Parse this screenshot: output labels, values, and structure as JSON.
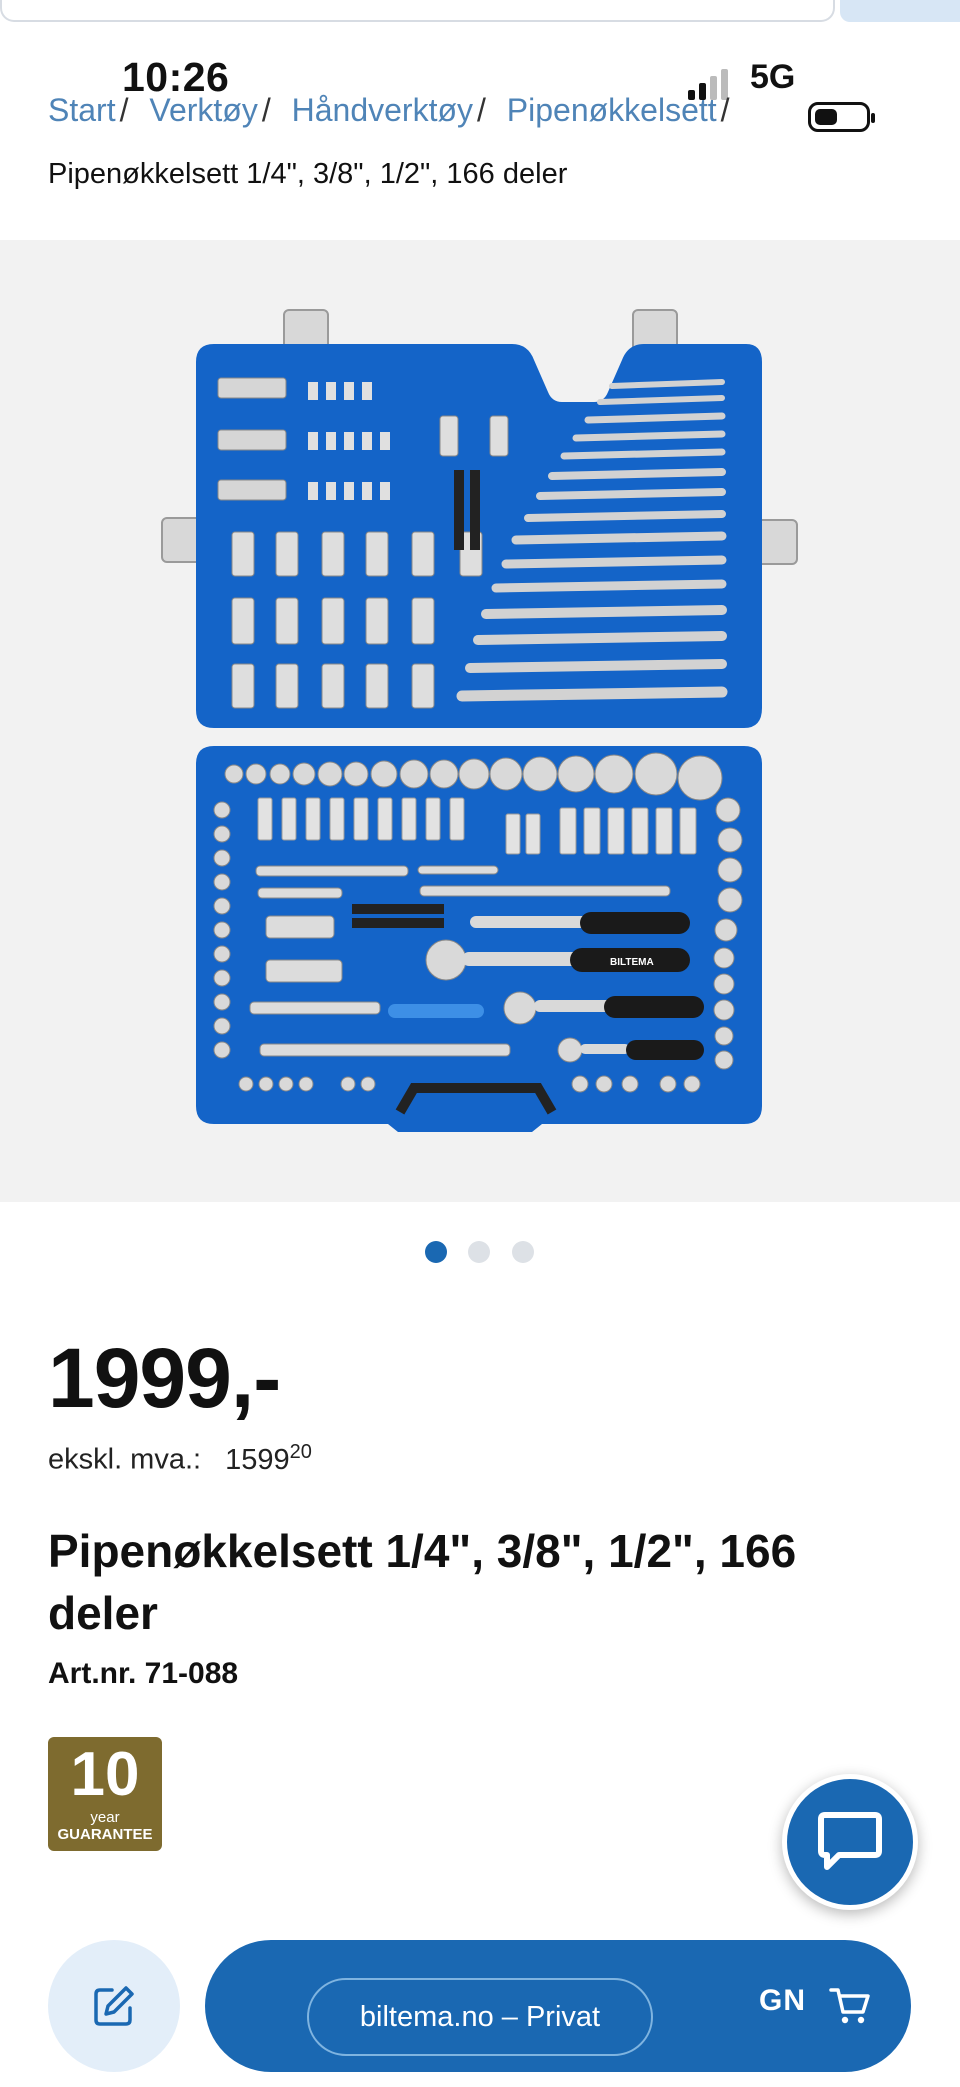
{
  "status_bar": {
    "time": "10:26",
    "network": "5G"
  },
  "breadcrumb": {
    "items": [
      "Start",
      "Verktøy",
      "Håndverktøy",
      "Pipenøkkelsett"
    ],
    "separator": "/",
    "current": "Pipenøkkelsett 1/4\", 3/8\", 1/2\", 166 deler"
  },
  "gallery": {
    "image_count": 3,
    "active_index": 0,
    "brand_text": "BILTEMA"
  },
  "product": {
    "price": "1999,-",
    "vat_label": "ekskl. mva.:",
    "vat_amount": "1599",
    "vat_cents": "20",
    "title": "Pipenøkkelsett 1/4\", 3/8\", 1/2\", 166 deler",
    "art_nr": "Art.nr. 71-088"
  },
  "guarantee": {
    "years": "10",
    "year_label": "year",
    "label": "GUARANTEE"
  },
  "actions": {
    "cart_label_partial": "GN"
  },
  "browser": {
    "url_pill": "biltema.no – Privat"
  },
  "colors": {
    "accent": "#1a68b2",
    "link": "#4f84b7",
    "guarantee": "#7e6b2f",
    "case_blue": "#1464c8"
  }
}
